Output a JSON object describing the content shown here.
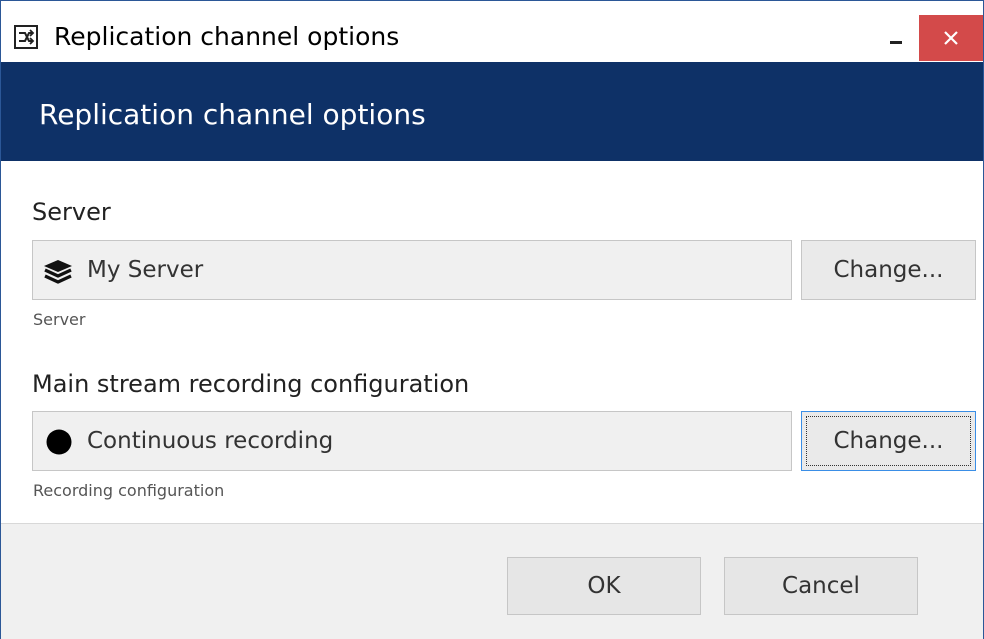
{
  "window": {
    "title": "Replication channel options",
    "minimize_icon": "minimize-icon",
    "close_icon": "close-icon",
    "app_icon": "replication-app-icon"
  },
  "header": {
    "title": "Replication channel options",
    "background_color": "#0e3167"
  },
  "server": {
    "label": "Server",
    "value": "My Server",
    "icon": "server-stack-icon",
    "change_label": "Change...",
    "hint": "Server"
  },
  "recording": {
    "label": "Main stream recording configuration",
    "value": "Continuous recording",
    "icon": "record-dot-icon",
    "change_label": "Change...",
    "hint": "Recording configuration"
  },
  "footer": {
    "ok_label": "OK",
    "cancel_label": "Cancel"
  },
  "colors": {
    "close_button": "#d34a4a",
    "focus_border": "#3a8ee6"
  }
}
